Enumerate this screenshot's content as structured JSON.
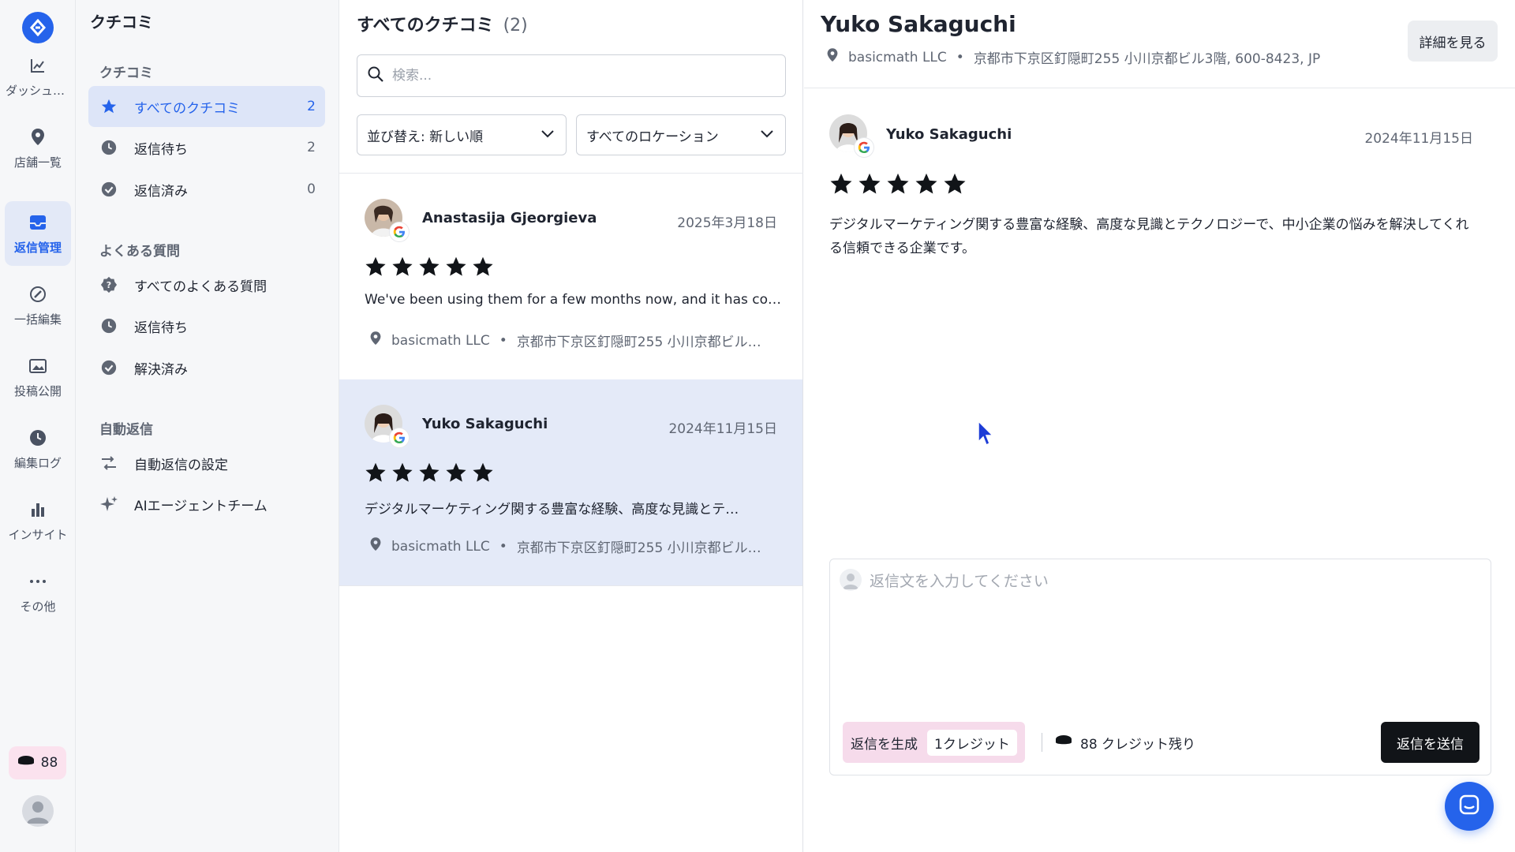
{
  "rail": {
    "items": [
      {
        "label": "ダッシュボード",
        "icon": "chart-line-icon"
      },
      {
        "label": "店舗一覧",
        "icon": "location-pin-icon"
      },
      {
        "label": "返信管理",
        "icon": "inbox-icon"
      },
      {
        "label": "一括編集",
        "icon": "bulk-edit-icon"
      },
      {
        "label": "投稿公開",
        "icon": "images-icon"
      },
      {
        "label": "編集ログ",
        "icon": "clock-icon"
      },
      {
        "label": "インサイト",
        "icon": "bar-chart-icon"
      },
      {
        "label": "その他",
        "icon": "more-dots-icon"
      }
    ],
    "credits": "88"
  },
  "subnav": {
    "title": "クチコミ",
    "sections": [
      {
        "label": "クチコミ",
        "items": [
          {
            "label": "すべてのクチコミ",
            "count": "2",
            "icon": "star-icon"
          },
          {
            "label": "返信待ち",
            "count": "2",
            "icon": "clock-icon"
          },
          {
            "label": "返信済み",
            "count": "0",
            "icon": "check-circle-icon"
          }
        ]
      },
      {
        "label": "よくある質問",
        "items": [
          {
            "label": "すべてのよくある質問",
            "icon": "question-badge-icon"
          },
          {
            "label": "返信待ち",
            "icon": "clock-icon"
          },
          {
            "label": "解決済み",
            "icon": "check-circle-icon"
          }
        ]
      },
      {
        "label": "自動返信",
        "items": [
          {
            "label": "自動返信の設定",
            "icon": "auto-reply-icon"
          },
          {
            "label": "AIエージェントチーム",
            "icon": "sparkle-icon"
          }
        ]
      }
    ]
  },
  "list": {
    "title": "すべてのクチコミ",
    "count": "(2)",
    "search_placeholder": "検索...",
    "sort_label": "並び替え: 新しい順",
    "location_label": "すべてのロケーション",
    "reviews": [
      {
        "name": "Anastasija Gjeorgieva",
        "date": "2025年3月18日",
        "rating": 5,
        "text": "We've been using them for a few months now, and it has co…",
        "business": "basicmath LLC",
        "address": "京都市下京区釘隠町255 小川京都ビル…"
      },
      {
        "name": "Yuko Sakaguchi",
        "date": "2024年11月15日",
        "rating": 5,
        "text": "デジタルマーケティング関する豊富な経験、高度な見識とテ…",
        "business": "basicmath LLC",
        "address": "京都市下京区釘隠町255 小川京都ビル…"
      }
    ]
  },
  "detail": {
    "title": "Yuko Sakaguchi",
    "business": "basicmath LLC",
    "address": "京都市下京区釘隠町255 小川京都ビル3階, 600-8423, JP",
    "details_button": "詳細を見る",
    "reviewer": "Yuko Sakaguchi",
    "date": "2024年11月15日",
    "rating": 5,
    "text": "デジタルマーケティング関する豊富な経験、高度な見識とテクノロジーで、中小企業の悩みを解決してくれる信頼できる企業です。",
    "reply_placeholder": "返信文を入力してください",
    "generate_label": "返信を生成",
    "generate_credit": "1クレジット",
    "remaining": "88 クレジット残り",
    "send_label": "返信を送信"
  },
  "colors": {
    "accent": "#2563eb",
    "selected_bg": "#e4eaf8",
    "generate_bg": "#f6dbeb",
    "send_bg": "#111418"
  }
}
